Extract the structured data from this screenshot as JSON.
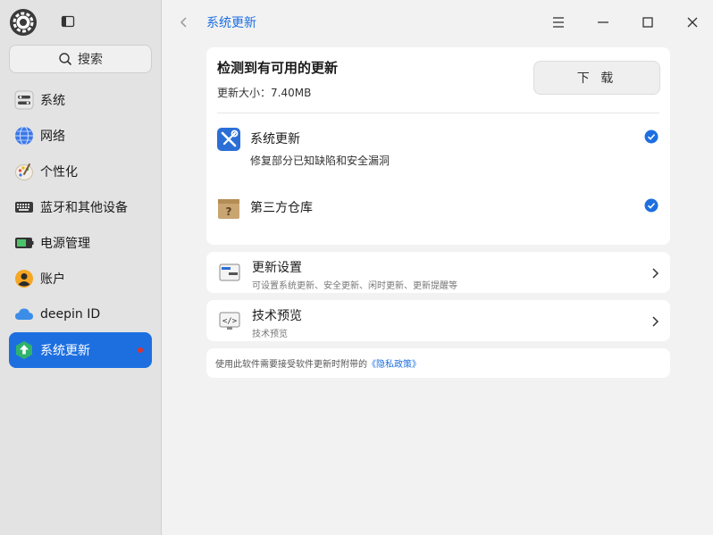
{
  "app": {
    "logo_icon": "settings-gear-icon",
    "sidebar_toggle_icon": "sidebar-toggle-icon"
  },
  "search": {
    "placeholder": "搜索",
    "icon": "search-icon"
  },
  "sidebar": {
    "items": [
      {
        "label": "系统",
        "icon": "system-icon",
        "active": false
      },
      {
        "label": "网络",
        "icon": "network-globe-icon",
        "active": false
      },
      {
        "label": "个性化",
        "icon": "palette-brush-icon",
        "active": false
      },
      {
        "label": "蓝牙和其他设备",
        "icon": "keyboard-devices-icon",
        "active": false
      },
      {
        "label": "电源管理",
        "icon": "battery-icon",
        "active": false
      },
      {
        "label": "账户",
        "icon": "account-user-icon",
        "active": false
      },
      {
        "label": "deepin ID",
        "icon": "cloud-icon",
        "active": false
      },
      {
        "label": "系统更新",
        "icon": "update-arrow-icon",
        "active": true,
        "badge": "red-dot"
      }
    ]
  },
  "header": {
    "title": "系统更新",
    "accent_color": "#1d6fe0"
  },
  "update_card": {
    "heading": "检测到有可用的更新",
    "size_text": "更新大小：7.40MB",
    "download_label": "下 载",
    "items": [
      {
        "name": "系统更新",
        "desc": "修复部分已知缺陷和安全漏洞",
        "icon": "system-update-tools-icon",
        "checked": true
      },
      {
        "name": "第三方仓库",
        "desc": "",
        "icon": "package-box-icon",
        "checked": true
      }
    ]
  },
  "settings_rows": [
    {
      "title": "更新设置",
      "subtitle": "可设置系统更新、安全更新、闲时更新、更新提醒等",
      "icon": "update-settings-icon"
    },
    {
      "title": "技术预览",
      "subtitle": "技术预览",
      "icon": "code-preview-icon"
    }
  ],
  "privacy": {
    "text": "使用此软件需要接受软件更新时附带的",
    "link": "《隐私政策》"
  }
}
